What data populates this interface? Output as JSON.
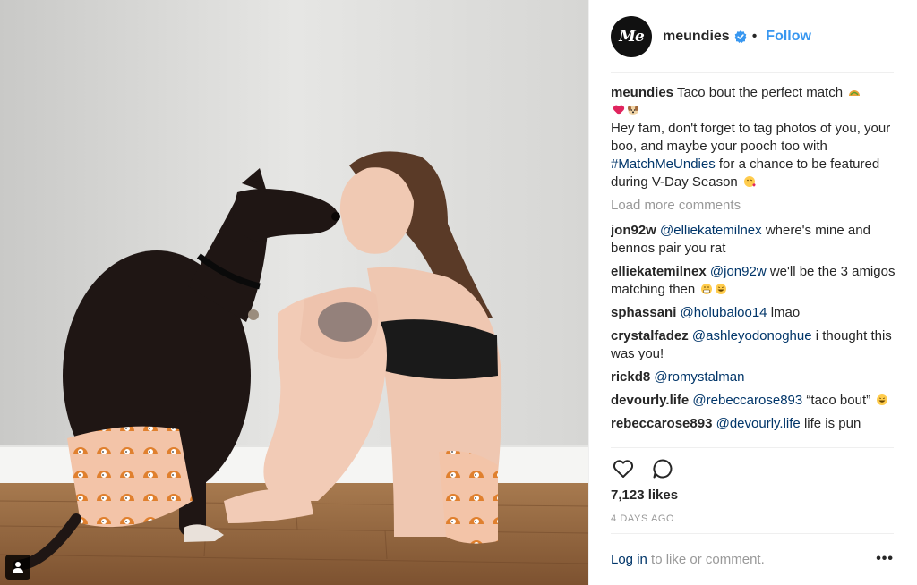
{
  "colors": {
    "accent": "#3897f0",
    "mention": "#003569",
    "muted": "#999999",
    "text": "#262626"
  },
  "photo": {
    "image_description_icon": "user-tag-icon"
  },
  "header": {
    "avatar_text": "Me",
    "username": "meundies",
    "verified_icon": "verified-badge-icon",
    "separator": "•",
    "follow_label": "Follow"
  },
  "caption": {
    "username": "meundies",
    "line1": "Taco bout the perfect match",
    "line2_a": "Hey fam, don't forget to tag photos of you, your boo, and maybe your pooch too with",
    "hashtag": "#MatchMeUndies",
    "line2_b": "for a chance to be featured during V-Day Season"
  },
  "load_more": "Load more comments",
  "comments": [
    {
      "user": "jon92w",
      "mention": "@elliekatemilnex",
      "text": "where's mine and bennos pair you rat"
    },
    {
      "user": "elliekatemilnex",
      "mention": "@jon92w",
      "text": "we'll be the 3 amigos matching then"
    },
    {
      "user": "sphassani",
      "mention": "@holubaloo14",
      "text": "lmao"
    },
    {
      "user": "crystalfadez",
      "mention": "@ashleyodonoghue",
      "text": "i thought this was you!"
    },
    {
      "user": "rickd8",
      "mention": "@romystalman",
      "text": ""
    },
    {
      "user": "devourly.life",
      "mention": "@rebeccarose893",
      "text": "“taco bout”"
    },
    {
      "user": "rebeccarose893",
      "mention": "@devourly.life",
      "text": "life is pun"
    }
  ],
  "actions": {
    "like_icon": "heart-icon",
    "comment_icon": "comment-icon"
  },
  "likes": "7,123 likes",
  "timestamp": "4 DAYS AGO",
  "footer": {
    "login_label": "Log in",
    "rest": "to like or comment.",
    "more_label": "•••"
  }
}
